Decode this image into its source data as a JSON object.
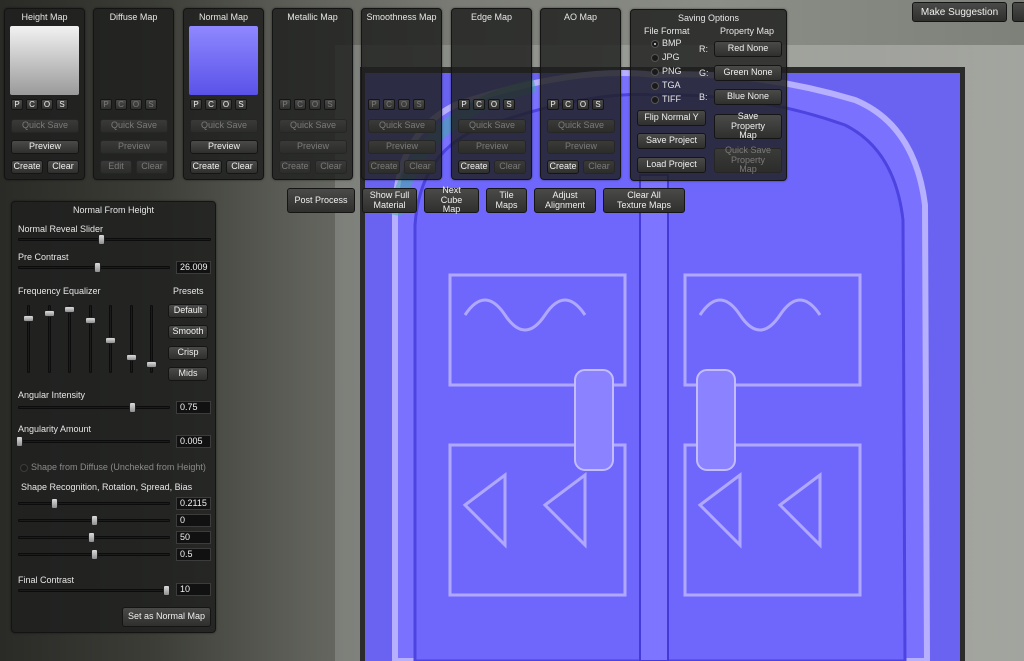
{
  "top_button": "Make Suggestion",
  "map_panels": [
    {
      "title": "Height Map",
      "buttons": [
        "Quick Save",
        "Preview",
        "Create",
        "Clear"
      ]
    },
    {
      "title": "Diffuse Map",
      "buttons": [
        "Quick Save",
        "Preview",
        "Edit",
        "Clear"
      ]
    },
    {
      "title": "Normal Map",
      "buttons": [
        "Quick Save",
        "Preview",
        "Create",
        "Clear"
      ]
    },
    {
      "title": "Metallic Map",
      "buttons": [
        "Quick Save",
        "Preview",
        "Create",
        "Clear"
      ]
    },
    {
      "title": "Smoothness Map",
      "buttons": [
        "Quick Save",
        "Preview",
        "Create",
        "Clear"
      ]
    },
    {
      "title": "Edge Map",
      "buttons": [
        "Quick Save",
        "Preview",
        "Create",
        "Clear"
      ]
    },
    {
      "title": "AO Map",
      "buttons": [
        "Quick Save",
        "Preview",
        "Create",
        "Clear"
      ]
    }
  ],
  "channel_toggles": [
    "P",
    "C",
    "O",
    "S"
  ],
  "saving": {
    "title": "Saving Options",
    "file_format_label": "File Format",
    "formats": [
      "BMP",
      "JPG",
      "PNG",
      "TGA",
      "TIFF"
    ],
    "selected_format": "BMP",
    "property_map_label": "Property Map",
    "channels": [
      {
        "ch": "R:",
        "value": "Red None"
      },
      {
        "ch": "G:",
        "value": "Green None"
      },
      {
        "ch": "B:",
        "value": "Blue None"
      }
    ],
    "flip_normal": "Flip Normal Y",
    "save_project": "Save Project",
    "load_project": "Load Project",
    "save_property_map": "Save Property Map",
    "quick_save_property_map": "Quick Save Property Map"
  },
  "toolbar": {
    "post_process": "Post Process",
    "show_full_material": "Show Full Material",
    "next_cube_map": "Next Cube Map",
    "tile_maps": "Tile Maps",
    "adjust_alignment": "Adjust Alignment",
    "clear_all": "Clear All Texture Maps"
  },
  "normal_panel": {
    "title": "Normal From Height",
    "reveal_label": "Normal Reveal Slider",
    "reveal_value": 0.43,
    "pre_contrast_label": "Pre Contrast",
    "pre_contrast_value": "26.009",
    "pre_contrast_pos": 0.52,
    "freq_label": "Frequency Equalizer",
    "presets_label": "Presets",
    "presets": [
      "Default",
      "Smooth",
      "Crisp",
      "Mids"
    ],
    "eq_levels": [
      0.18,
      0.1,
      0.05,
      0.2,
      0.5,
      0.75,
      0.86
    ],
    "angular_intensity_label": "Angular Intensity",
    "angular_intensity_value": "0.75",
    "angular_intensity_pos": 0.75,
    "angularity_label": "Angularity Amount",
    "angularity_value": "0.005",
    "angularity_pos": 0.0,
    "shape_diffuse_label": "Shape from Diffuse (Uncheked from Height)",
    "shape_recog_label": "Shape Recognition, Rotation, Spread, Bias",
    "shape_rows": [
      {
        "value": "0.2115",
        "pos": 0.23
      },
      {
        "value": "0",
        "pos": 0.5
      },
      {
        "value": "50",
        "pos": 0.48
      },
      {
        "value": "0.5",
        "pos": 0.5
      }
    ],
    "final_contrast_label": "Final Contrast",
    "final_contrast_value": "10",
    "final_contrast_pos": 0.98,
    "set_button": "Set as Normal Map"
  }
}
